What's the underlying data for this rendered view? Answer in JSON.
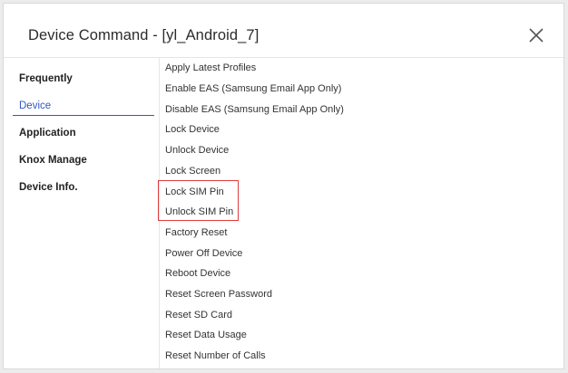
{
  "dialog": {
    "title": "Device Command - [yl_Android_7]",
    "close_icon": "close-x-icon"
  },
  "sidebar": {
    "items": [
      {
        "label": "Frequently",
        "active": false
      },
      {
        "label": "Device",
        "active": true
      },
      {
        "label": "Application",
        "active": false
      },
      {
        "label": "Knox Manage",
        "active": false
      },
      {
        "label": "Device Info.",
        "active": false
      }
    ]
  },
  "commands": [
    "Apply Latest Profiles",
    "Enable EAS (Samsung Email App Only)",
    "Disable EAS (Samsung Email App Only)",
    "Lock Device",
    "Unlock Device",
    "Lock Screen",
    "Lock SIM Pin",
    "Unlock SIM Pin",
    "Factory Reset",
    "Power Off Device",
    "Reboot Device",
    "Reset Screen Password",
    "Reset SD Card",
    "Reset Data Usage",
    "Reset Number of Calls"
  ],
  "colors": {
    "accent": "#2f57c6",
    "highlight_border": "#e03c3c"
  }
}
